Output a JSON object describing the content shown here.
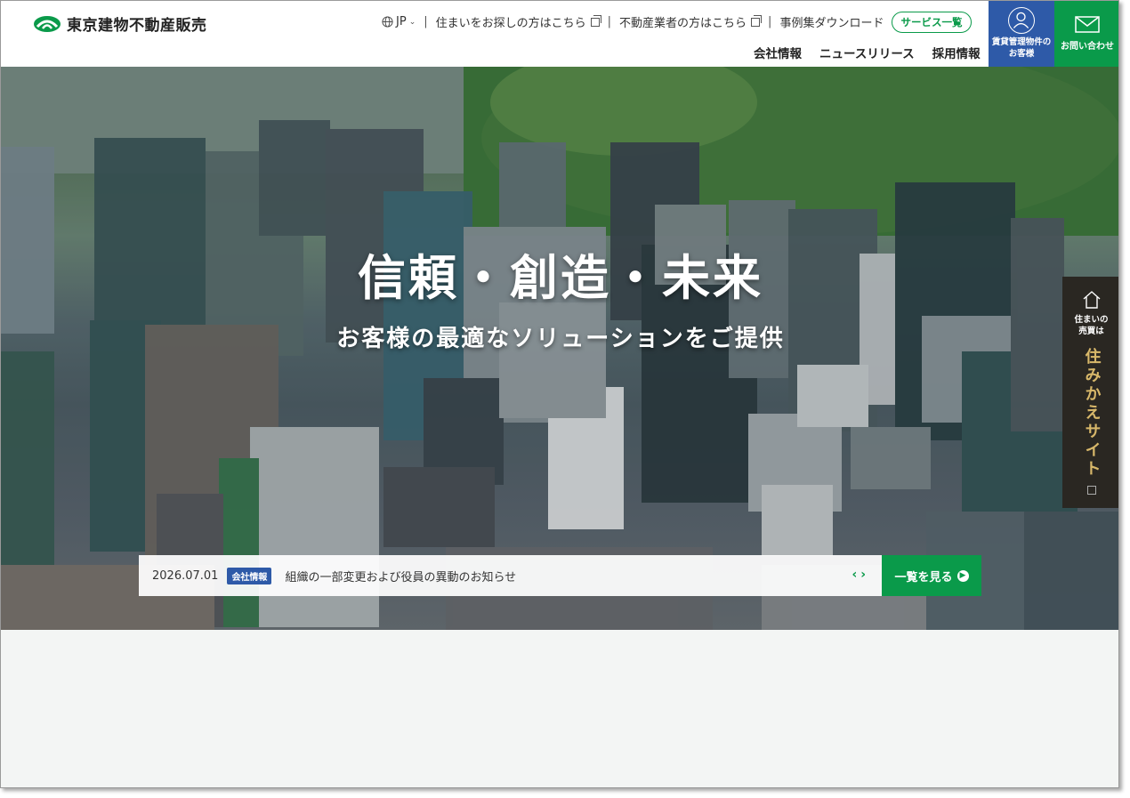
{
  "brand": {
    "name": "東京建物不動産販売"
  },
  "util_nav": {
    "lang": "JP",
    "items": [
      {
        "label": "住まいをお探しの方はこちら"
      },
      {
        "label": "不動産業者の方はこちら"
      },
      {
        "label": "事例集ダウンロード"
      }
    ]
  },
  "service_button": "サービス一覧",
  "main_nav": [
    "会社情報",
    "ニュースリリース",
    "採用情報"
  ],
  "tenant_button": {
    "line1": "賃貸管理物件の",
    "line2": "お客様"
  },
  "contact_button": "お問い合わせ",
  "hero": {
    "title": "信頼・創造・未来",
    "subtitle": "お客様の最適なソリューションをご提供"
  },
  "side_tab": {
    "small1": "住まいの",
    "small2": "売買は",
    "big": "住みかえサイト"
  },
  "news": {
    "date": "2026.07.01",
    "category": "会社情報",
    "title": "組織の一部変更および役員の異動のお知らせ",
    "more_label": "一覧を見る"
  },
  "colors": {
    "green": "#0a9a4a",
    "blue": "#2e5aa8",
    "dark": "#2a2722",
    "gold": "#d8b86a"
  }
}
